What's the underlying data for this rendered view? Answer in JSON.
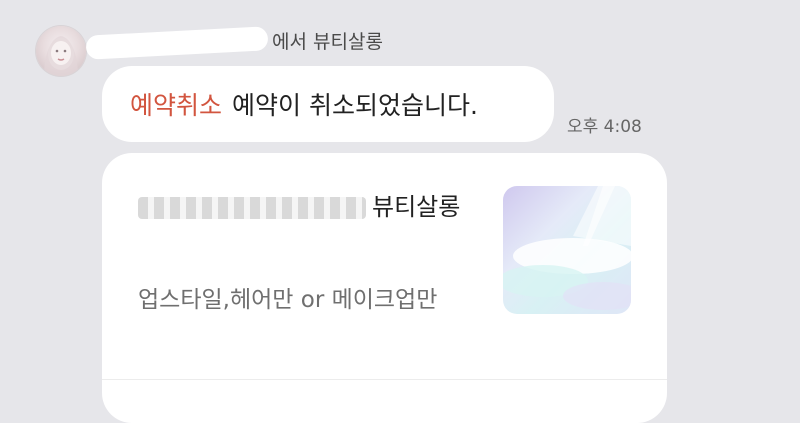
{
  "sender": {
    "name_visible": "에서 뷰티살롱"
  },
  "message": {
    "tag": "예약취소",
    "text": "예약이 취소되었습니다.",
    "time": "오후 4:08"
  },
  "card": {
    "title": "뷰티살롱",
    "subtitle": "업스타일,헤어만 or 메이크업만"
  },
  "colors": {
    "background": "#e6e6ea",
    "bubble": "#ffffff",
    "tag": "#d2553f"
  }
}
